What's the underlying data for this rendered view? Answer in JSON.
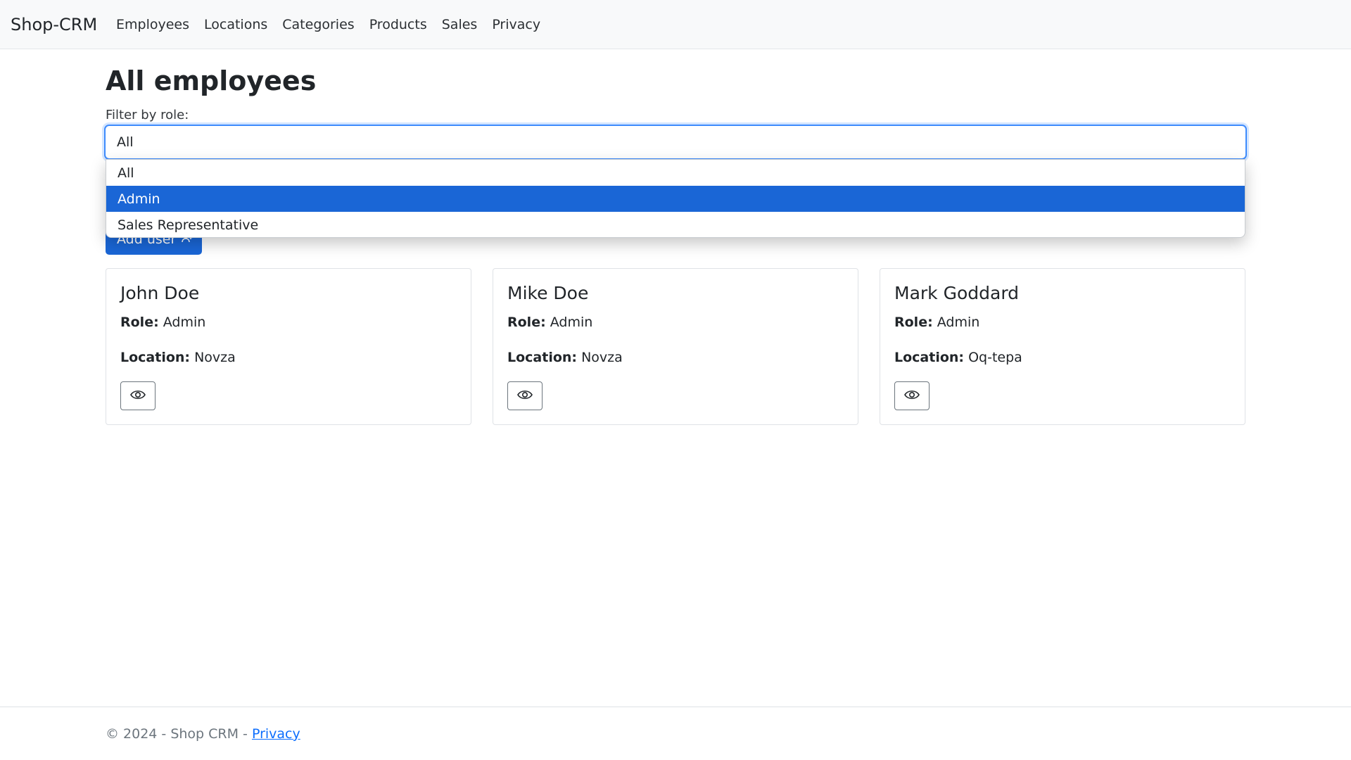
{
  "navbar": {
    "brand": "Shop-CRM",
    "links": [
      "Employees",
      "Locations",
      "Categories",
      "Products",
      "Sales",
      "Privacy"
    ]
  },
  "main": {
    "title": "All employees",
    "filter_label": "Filter by role:",
    "filter_value": "All",
    "add_user_label": "Add user",
    "dropdown_options": [
      "All",
      "Admin",
      "Sales Representative"
    ],
    "highlighted_option": "Admin",
    "role_label": "Role:",
    "location_label": "Location:",
    "employees": [
      {
        "name": "John Doe",
        "role": "Admin",
        "location": "Novza"
      },
      {
        "name": "Mike Doe",
        "role": "Admin",
        "location": "Novza"
      },
      {
        "name": "Mark Goddard",
        "role": "Admin",
        "location": "Oq-tepa"
      }
    ]
  },
  "footer": {
    "text": "© 2024 - Shop CRM - ",
    "link": "Privacy"
  },
  "colors": {
    "primary": "#1a66d6",
    "focus_border": "#3d8bfd",
    "navbar_bg": "#f8f9fa",
    "link": "#0d6efd"
  },
  "icons": {
    "view": "eye-icon",
    "add": "person-plus-icon"
  }
}
